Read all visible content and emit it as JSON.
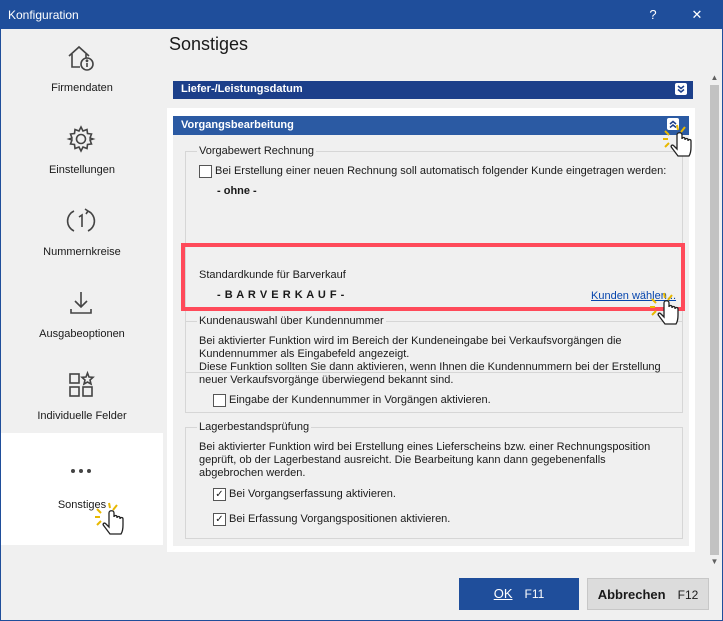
{
  "window": {
    "title": "Konfiguration",
    "help": "?",
    "close": "✕"
  },
  "sidebar": {
    "items": [
      {
        "label": "Firmendaten",
        "icon": "home-info-icon"
      },
      {
        "label": "Einstellungen",
        "icon": "gear-icon"
      },
      {
        "label": "Nummernkreise",
        "icon": "number-cycle-icon"
      },
      {
        "label": "Ausgabeoptionen",
        "icon": "download-icon"
      },
      {
        "label": "Individuelle Felder",
        "icon": "custom-fields-icon"
      },
      {
        "label": "Sonstiges",
        "icon": "more-dots-icon",
        "active": true
      }
    ]
  },
  "main": {
    "title": "Sonstiges",
    "collapsed_section": "Liefer-/Leistungsdatum",
    "section": {
      "title": "Vorgangsbearbeitung",
      "groups": {
        "default_invoice": {
          "legend": "Vorgabewert Rechnung",
          "checkbox_label": "Bei Erstellung einer neuen Rechnung soll automatisch folgender Kunde eingetragen werden:",
          "checked": false,
          "value": "- ohne -"
        },
        "cash_sale": {
          "legend": "Standardkunde für Barverkauf",
          "value": "- B A R V E R K A U F -",
          "link": "Kunden wählen..."
        },
        "customer_number": {
          "legend": "Kundenauswahl über Kundennummer",
          "desc_1": "Bei aktivierter Funktion wird im Bereich der Kundeneingabe bei Verkaufsvorgängen die",
          "desc_2": "Kundennummer als Eingabefeld angezeigt.",
          "desc_3": "Diese Funktion sollten Sie dann aktivieren, wenn Ihnen die Kundennummern bei der Erstellung",
          "desc_4": "neuer Verkaufsvorgänge überwiegend bekannt sind.",
          "checkbox_label": "Eingabe der Kundennummer in Vorgängen aktivieren.",
          "checked": false
        },
        "stock_check": {
          "legend": "Lagerbestandsprüfung",
          "desc_1": "Bei aktivierter Funktion wird bei Erstellung eines Lieferscheins bzw. einer Rechnungsposition",
          "desc_2": "geprüft, ob der Lagerbestand ausreicht. Die Bearbeitung kann dann gegebenenfalls",
          "desc_3": "abgebrochen werden.",
          "checkbox_1_label": "Bei Vorgangserfassung aktivieren.",
          "checkbox_1_checked": true,
          "checkbox_2_label": "Bei Erfassung Vorgangspositionen aktivieren.",
          "checkbox_2_checked": true
        }
      }
    }
  },
  "footer": {
    "ok_label": "OK",
    "ok_key": "F11",
    "cancel_label": "Abbrechen",
    "cancel_key": "F12"
  },
  "colors": {
    "accent": "#1f4e9b",
    "highlight": "#ff4a5a",
    "link": "#0645ad"
  }
}
